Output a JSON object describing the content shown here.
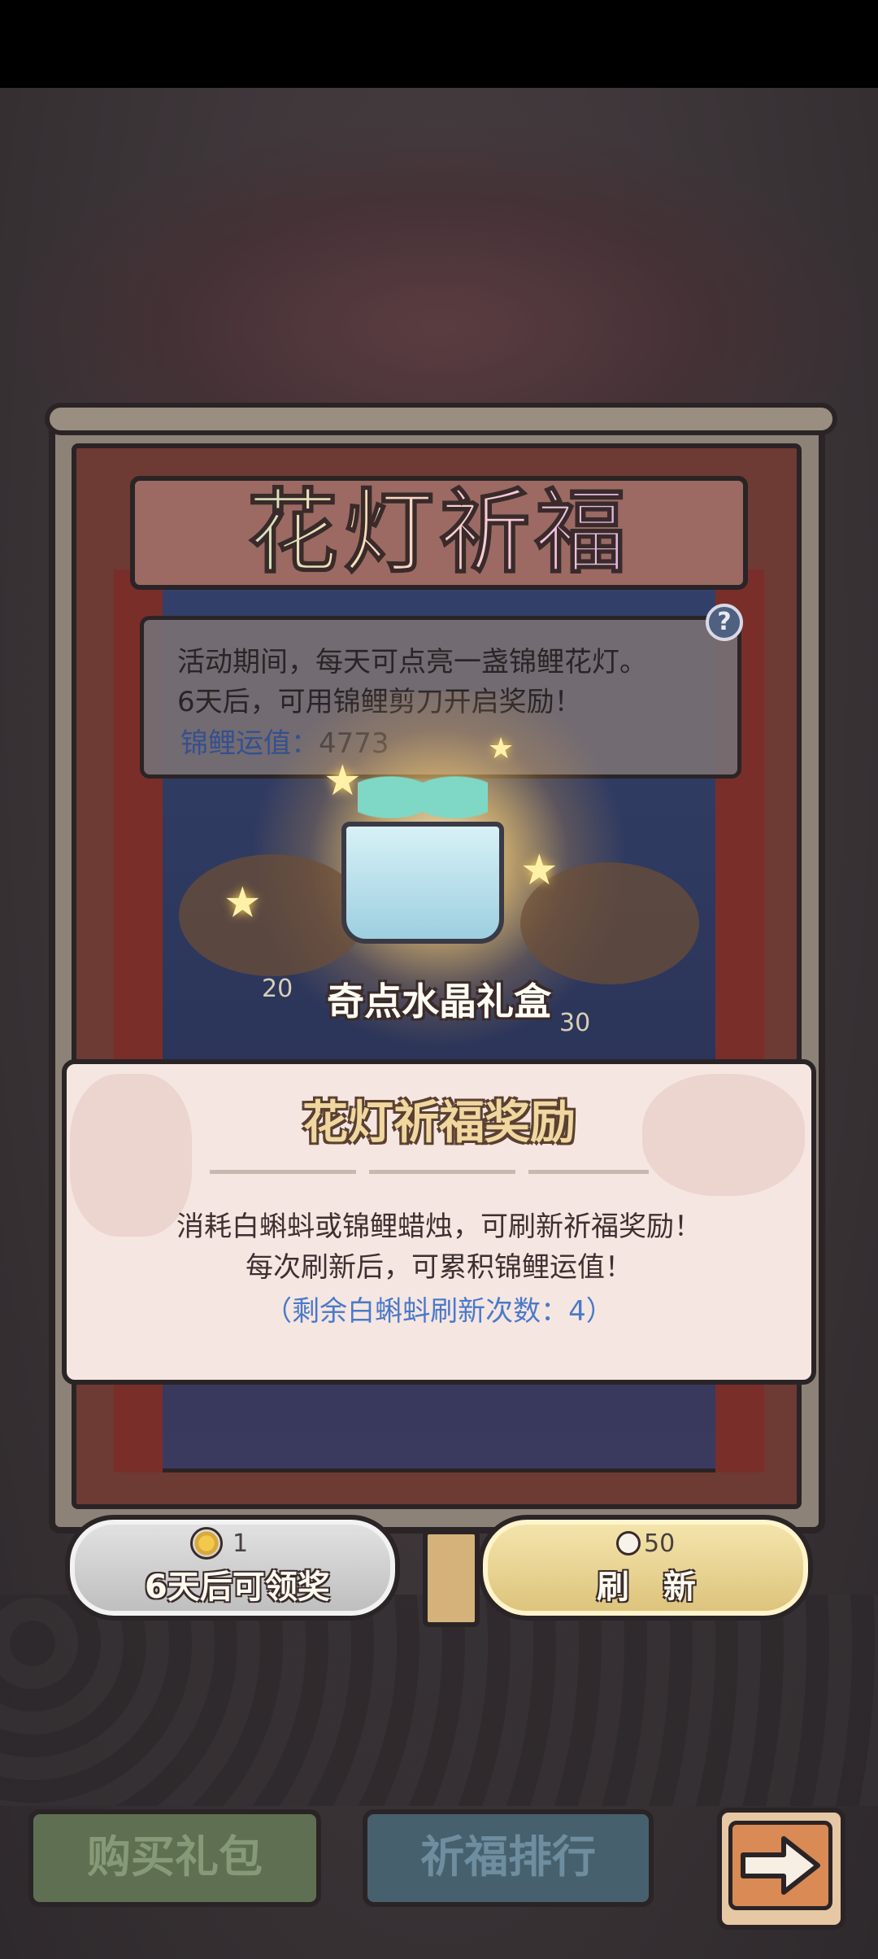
{
  "event": {
    "title": "花灯祈福",
    "info_line1": "活动期间，每天可点亮一盏锦鲤花灯。",
    "info_line2": "6天后，可用锦鲤剪刀开启奖励！",
    "luck_label": "锦鲤运值：",
    "luck_value": "4773",
    "help_symbol": "?"
  },
  "reward": {
    "name": "奇点水晶礼盒",
    "left_number": "20",
    "right_number": "30"
  },
  "popup": {
    "title": "花灯祈福奖励",
    "line1": "消耗白蝌蚪或锦鲤蜡烛，可刷新祈福奖励！",
    "line2": "每次刷新后，可累积锦鲤运值！",
    "line3": "（剩余白蝌蚪刷新次数：4）"
  },
  "buttons": {
    "claim_cost": "1",
    "claim_label": "6天后可领奖",
    "refresh_cost": "50",
    "refresh_label": "刷 新",
    "buy_pack_label": "购买礼包",
    "ranking_label": "祈福排行"
  },
  "icons": {
    "help": "question-icon",
    "claim_cost": "bee-icon",
    "refresh_cost": "tadpole-icon",
    "next": "arrow-right-icon"
  },
  "colors": {
    "luck_label": "#35508e",
    "popup_highlight": "#4a7ac8",
    "refresh_button": "#f5e6ae",
    "claim_button": "#d6d6d6"
  }
}
